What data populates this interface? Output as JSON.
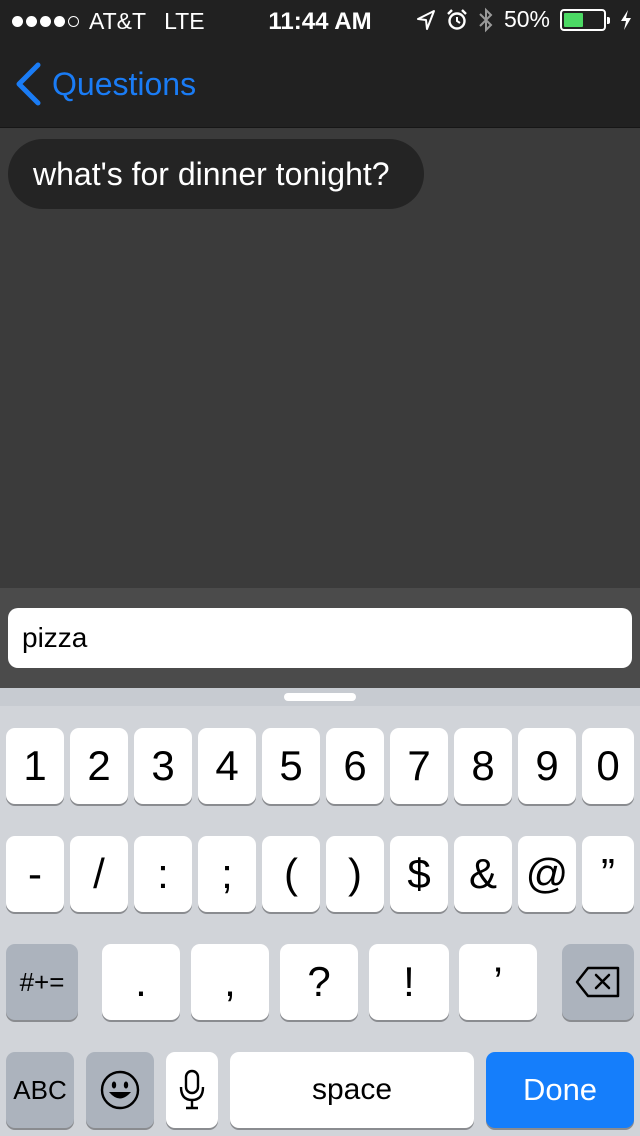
{
  "status_bar": {
    "carrier": "AT&T",
    "network": "LTE",
    "time": "11:44 AM",
    "battery": "50%",
    "battery_level": 0.5,
    "signal_filled": 4,
    "signal_total": 5,
    "icons": [
      "location-icon",
      "alarm-icon",
      "bluetooth-icon",
      "charging-icon"
    ]
  },
  "nav": {
    "back_label": "Questions",
    "accent_color": "#1a7cf5"
  },
  "chat": {
    "messages": [
      {
        "text": "what's for dinner tonight?"
      }
    ]
  },
  "input": {
    "value": "pizza"
  },
  "keyboard": {
    "row1": [
      "1",
      "2",
      "3",
      "4",
      "5",
      "6",
      "7",
      "8",
      "9",
      "0"
    ],
    "row2": [
      "-",
      "/",
      ":",
      ";",
      "(",
      ")",
      "$",
      "&",
      "@",
      "”"
    ],
    "row3_left": "#+=",
    "row3": [
      ".",
      ",",
      "?",
      "!",
      "’"
    ],
    "abc": "ABC",
    "space": "space",
    "done": "Done",
    "done_color": "#157efb"
  }
}
